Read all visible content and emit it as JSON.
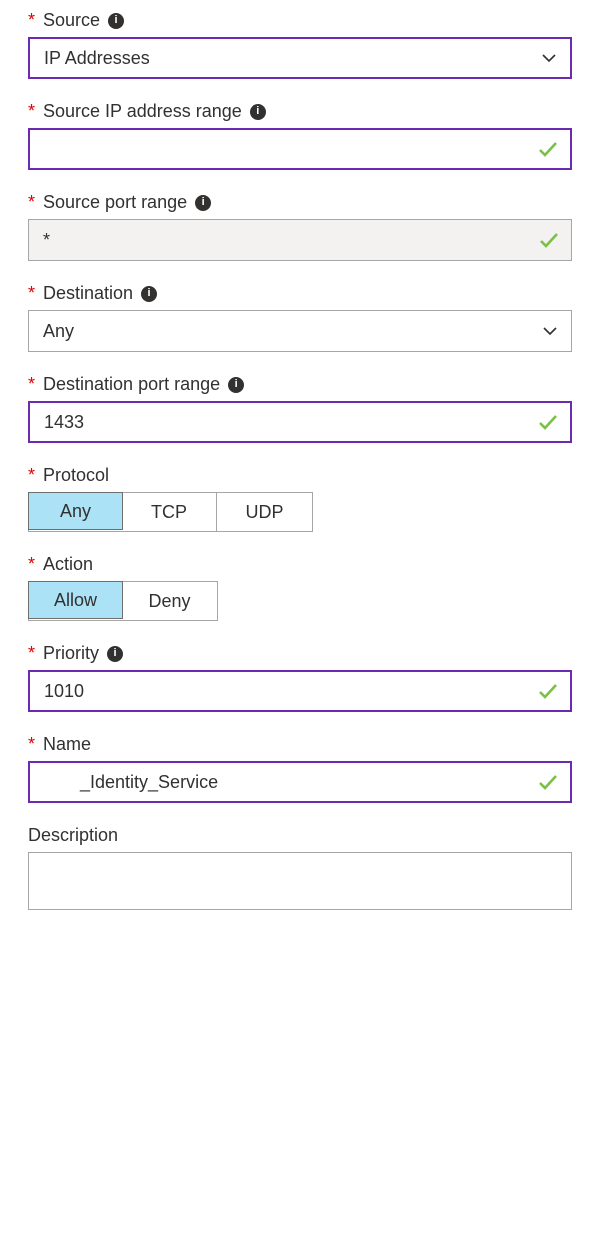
{
  "fields": {
    "source": {
      "label": "Source",
      "value": "IP Addresses",
      "required": true,
      "info": true
    },
    "source_ip": {
      "label": "Source IP address range",
      "value": "",
      "required": true,
      "info": true
    },
    "source_port": {
      "label": "Source port range",
      "value": "*",
      "required": true,
      "info": true
    },
    "destination": {
      "label": "Destination",
      "value": "Any",
      "required": true,
      "info": true
    },
    "destination_port": {
      "label": "Destination port range",
      "value": "1433",
      "required": true,
      "info": true
    },
    "protocol": {
      "label": "Protocol",
      "options": [
        "Any",
        "TCP",
        "UDP"
      ],
      "selected": "Any",
      "required": true
    },
    "action": {
      "label": "Action",
      "options": [
        "Allow",
        "Deny"
      ],
      "selected": "Allow",
      "required": true
    },
    "priority": {
      "label": "Priority",
      "value": "1010",
      "required": true,
      "info": true
    },
    "name": {
      "label": "Name",
      "value": "_Identity_Service",
      "required": true
    },
    "description": {
      "label": "Description",
      "value": "",
      "required": false
    }
  }
}
